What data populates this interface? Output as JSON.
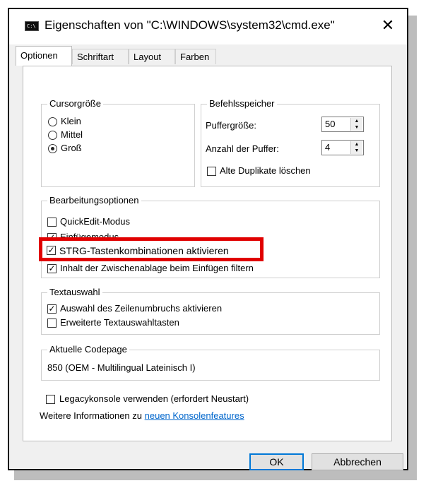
{
  "window": {
    "title": "Eigenschaften von \"C:\\WINDOWS\\system32\\cmd.exe\"",
    "icon_text": "C:\\",
    "close_glyph": "✕"
  },
  "tabs": [
    {
      "label": "Optionen",
      "active": true
    },
    {
      "label": "Schriftart",
      "active": false
    },
    {
      "label": "Layout",
      "active": false
    },
    {
      "label": "Farben",
      "active": false
    }
  ],
  "cursor_size": {
    "legend": "Cursorgröße",
    "options": [
      {
        "label": "Klein",
        "selected": false
      },
      {
        "label": "Mittel",
        "selected": false
      },
      {
        "label": "Groß",
        "selected": true
      }
    ]
  },
  "command_buffer": {
    "legend": "Befehlsspeicher",
    "buffer_size_label": "Puffergröße:",
    "buffer_size_value": "50",
    "buffer_count_label": "Anzahl der Puffer:",
    "buffer_count_value": "4",
    "discard_duplicates_label": "Alte Duplikate löschen",
    "discard_duplicates_checked": false
  },
  "edit_options": {
    "legend": "Bearbeitungsoptionen",
    "items": [
      {
        "label": "QuickEdit-Modus",
        "checked": false
      },
      {
        "label": "Einfügemodus",
        "checked": true
      },
      {
        "label": "STRG-Tastenkombinationen aktivieren",
        "checked": true
      },
      {
        "label": "Inhalt der Zwischenablage beim Einfügen filtern",
        "checked": true
      }
    ]
  },
  "text_selection": {
    "legend": "Textauswahl",
    "items": [
      {
        "label": "Auswahl des Zeilenumbruchs aktivieren",
        "checked": true
      },
      {
        "label": "Erweiterte Textauswahltasten",
        "checked": false
      }
    ]
  },
  "codepage": {
    "legend": "Aktuelle Codepage",
    "value": "850   (OEM - Multilingual Lateinisch I)"
  },
  "legacy": {
    "label": "Legacykonsole verwenden (erfordert Neustart)",
    "checked": false,
    "info_prefix": "Weitere Informationen zu ",
    "info_link": "neuen Konsolenfeatures"
  },
  "buttons": {
    "ok": "OK",
    "cancel": "Abbrechen"
  },
  "check_glyph": "✓",
  "up_glyph": "▲",
  "down_glyph": "▼",
  "colors": {
    "highlight": "#e00000",
    "link": "#0066cc",
    "default_button_border": "#0078d7"
  }
}
